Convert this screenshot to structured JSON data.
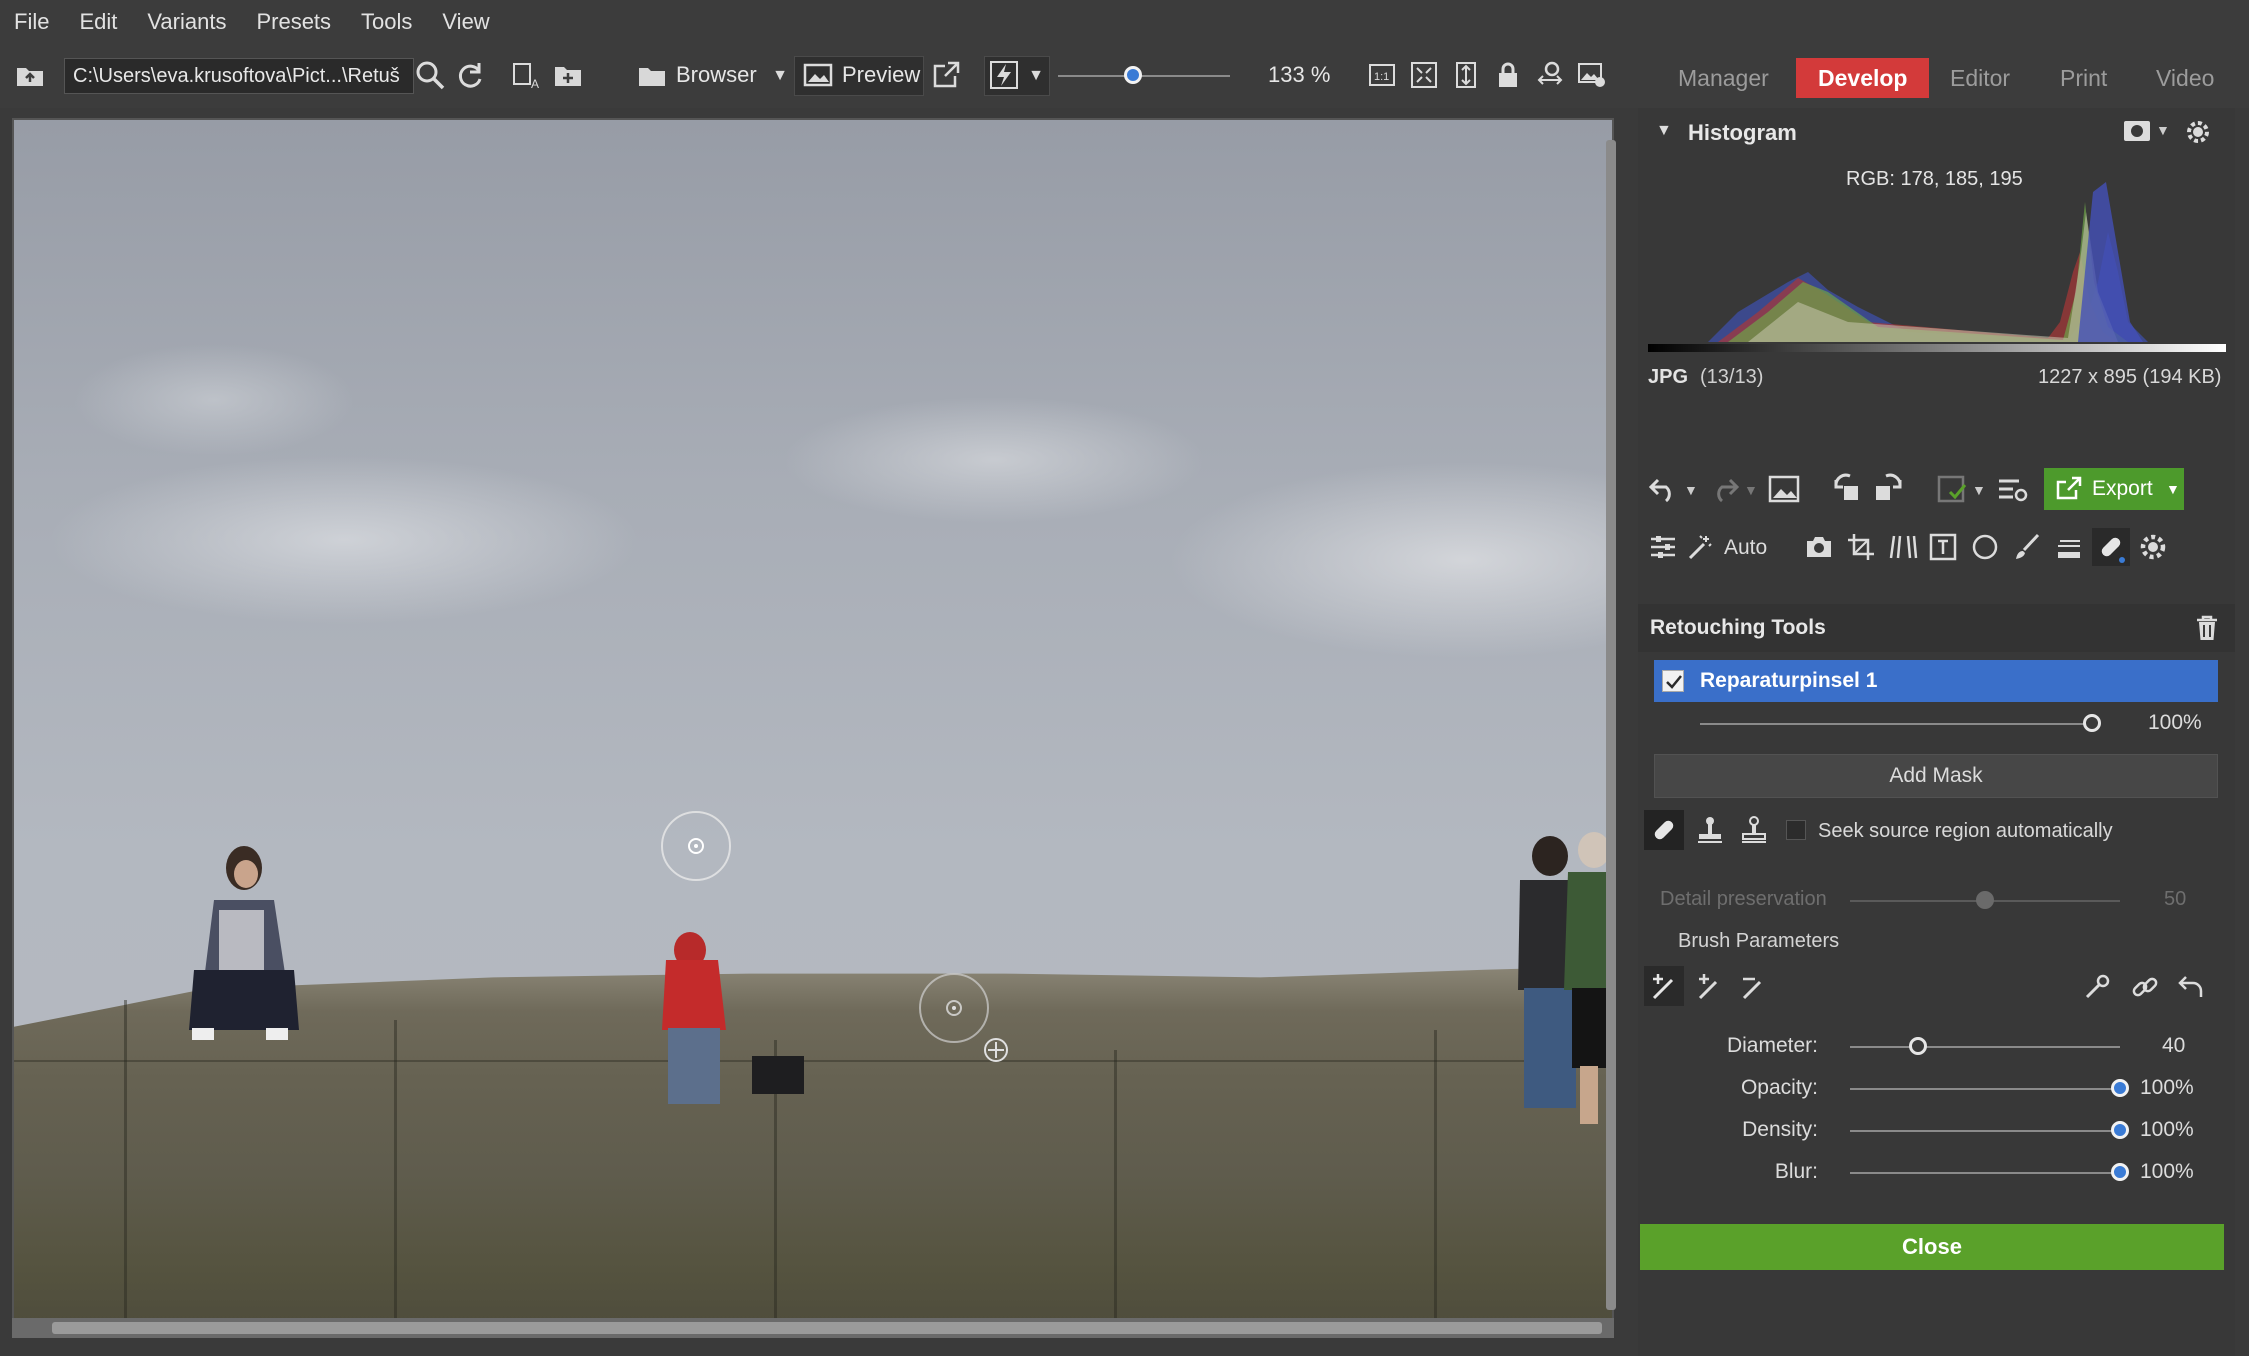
{
  "menu": [
    "File",
    "Edit",
    "Variants",
    "Presets",
    "Tools",
    "View"
  ],
  "toolbar": {
    "path": "C:\\Users\\eva.krusoftova\\Pict...\\Retuš",
    "browser_label": "Browser",
    "preview_label": "Preview",
    "zoom": "133 %"
  },
  "modules": {
    "manager": "Manager",
    "develop": "Develop",
    "editor": "Editor",
    "print": "Print",
    "video": "Video"
  },
  "histogram": {
    "title": "Histogram",
    "rgb": "RGB: 178, 185, 195",
    "format": "JPG",
    "index": "(13/13)",
    "dims": "1227 x 895 (194 KB)"
  },
  "actions": {
    "export": "Export",
    "auto": "Auto"
  },
  "retouch": {
    "title": "Retouching Tools",
    "layer_name": "Reparaturpinsel 1",
    "layer_checked": true,
    "layer_opacity": "100%",
    "layer_opacity_value": 1.0,
    "add_mask": "Add Mask",
    "seek_source": "Seek source region automatically",
    "detail_label": "Detail preservation",
    "detail_value": "50",
    "detail_fraction": 0.5
  },
  "brush": {
    "title": "Brush Parameters",
    "params": [
      {
        "label": "Diameter:",
        "value": "40",
        "fraction": 0.25
      },
      {
        "label": "Opacity:",
        "value": "100%",
        "fraction": 1.0
      },
      {
        "label": "Density:",
        "value": "100%",
        "fraction": 1.0
      },
      {
        "label": "Blur:",
        "value": "100%",
        "fraction": 1.0
      }
    ]
  },
  "close_label": "Close",
  "colors": {
    "develop_tab": "#d33a3a",
    "selected_row": "#3a6fc9",
    "close_button": "#5aa12a",
    "export_button": "#4d9a2c"
  }
}
